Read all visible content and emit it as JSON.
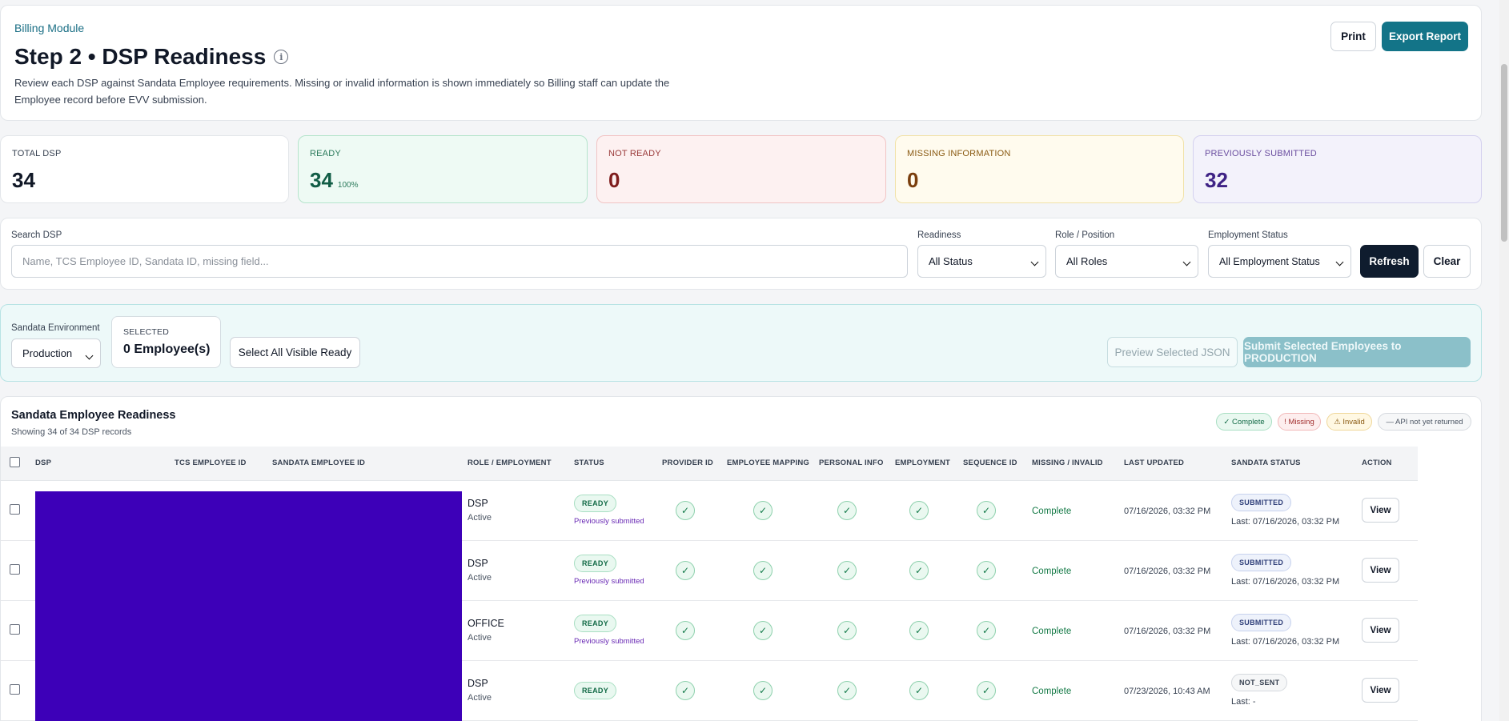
{
  "header": {
    "module": "Billing Module",
    "title": "Step 2 • DSP Readiness",
    "description": "Review each DSP against Sandata Employee requirements. Missing or invalid information is shown immediately so Billing staff can update the Employee record before EVV submission.",
    "print_label": "Print",
    "export_label": "Export Report"
  },
  "stats": {
    "total": {
      "label": "TOTAL DSP",
      "value": "34"
    },
    "ready": {
      "label": "READY",
      "value": "34",
      "percent": "100%"
    },
    "not_ready": {
      "label": "NOT READY",
      "value": "0"
    },
    "missing": {
      "label": "MISSING INFORMATION",
      "value": "0"
    },
    "previously_submitted": {
      "label": "PREVIOUSLY SUBMITTED",
      "value": "32"
    }
  },
  "filters": {
    "search_label": "Search DSP",
    "search_placeholder": "Name, TCS Employee ID, Sandata ID, missing field...",
    "readiness_label": "Readiness",
    "readiness_value": "All Status",
    "role_label": "Role / Position",
    "role_value": "All Roles",
    "employment_label": "Employment Status",
    "employment_value": "All Employment Status",
    "refresh_label": "Refresh",
    "clear_label": "Clear"
  },
  "submission": {
    "environment_label": "Sandata Environment",
    "environment_value": "Production",
    "selected_label": "SELECTED",
    "selected_value": "0 Employee(s)",
    "select_all_label": "Select All Visible Ready",
    "preview_label": "Preview Selected JSON",
    "submit_label": "Submit Selected Employees to PRODUCTION"
  },
  "table": {
    "title": "Sandata Employee Readiness",
    "subtitle": "Showing 34 of 34 DSP records",
    "legend": {
      "complete": "✓ Complete",
      "missing": "! Missing",
      "invalid": "⚠ Invalid",
      "not_returned": "— API not yet returned"
    },
    "columns": {
      "dsp": "DSP",
      "tcs_id": "TCS EMPLOYEE ID",
      "sandata_id": "SANDATA EMPLOYEE ID",
      "role": "ROLE / EMPLOYMENT",
      "status": "STATUS",
      "provider_id": "PROVIDER ID",
      "mapping": "EMPLOYEE MAPPING",
      "personal": "PERSONAL INFO",
      "employment": "EMPLOYMENT",
      "sequence": "SEQUENCE ID",
      "missing": "MISSING / INVALID",
      "updated": "LAST UPDATED",
      "sandata_status": "SANDATA STATUS",
      "action": "ACTION"
    },
    "check_glyph": "✓",
    "rows": [
      {
        "role": "DSP",
        "employment": "Active",
        "status": "READY",
        "status_sub": "Previously submitted",
        "missing": "Complete",
        "updated": "07/16/2026, 03:32 PM",
        "sandata_status": "SUBMITTED",
        "last": "Last: 07/16/2026, 03:32 PM",
        "action": "View"
      },
      {
        "role": "DSP",
        "employment": "Active",
        "status": "READY",
        "status_sub": "Previously submitted",
        "missing": "Complete",
        "updated": "07/16/2026, 03:32 PM",
        "sandata_status": "SUBMITTED",
        "last": "Last: 07/16/2026, 03:32 PM",
        "action": "View"
      },
      {
        "role": "OFFICE",
        "employment": "Active",
        "status": "READY",
        "status_sub": "Previously submitted",
        "missing": "Complete",
        "updated": "07/16/2026, 03:32 PM",
        "sandata_status": "SUBMITTED",
        "last": "Last: 07/16/2026, 03:32 PM",
        "action": "View"
      },
      {
        "role": "DSP",
        "employment": "Active",
        "status": "READY",
        "status_sub": "",
        "missing": "Complete",
        "updated": "07/23/2026, 10:43 AM",
        "sandata_status": "NOT_SENT",
        "last": "Last: -",
        "action": "View"
      }
    ]
  }
}
